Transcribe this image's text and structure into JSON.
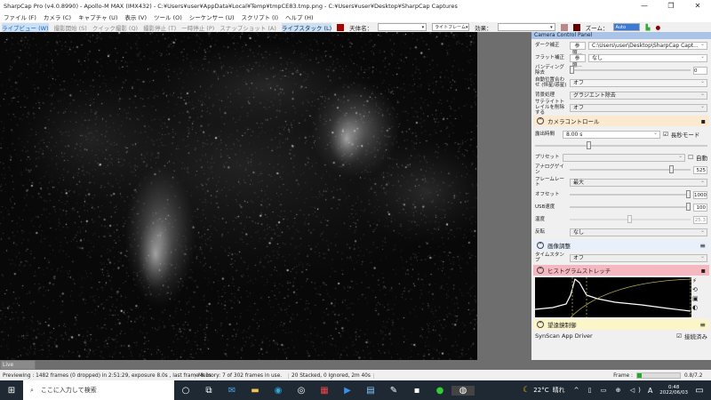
{
  "window": {
    "title": "SharpCap Pro (v4.0.8990) - Apollo-M MAX (IMX432) - C:¥Users¥user¥AppData¥Local¥Temp¥tmpCE83.tmp.png - C:¥Users¥user¥Desktop¥SharpCap Captures",
    "minimize": "—",
    "restore": "❐",
    "close": "✕"
  },
  "menu": [
    "ファイル (F)",
    "カメラ (C)",
    "キャプチャ (U)",
    "表示 (V)",
    "ツール (O)",
    "シーケンサー (U)",
    "スクリプト (I)",
    "ヘルプ (H)"
  ],
  "toolbar": {
    "live_view": "ライブビュー (W)",
    "start_capture": "撮影開始 (S)",
    "quick_capture": "クイック撮影 (Q)",
    "stop_capture": "撮影停止 (T)",
    "pause": "一時停止 (P)",
    "snapshot": "スナップショット (A)",
    "live_stack": "ライブスタック (L)",
    "target_label": "天体名：",
    "frame_type": "ライトフレーム",
    "effect_label": "効果：",
    "zoom_label": "ズーム：",
    "zoom_value": "Auto"
  },
  "panel": {
    "title": "Camera Control Panel",
    "dark_label": "ダーク補正",
    "dark_browse": "参照...",
    "dark_value": "C:\\Users\\user\\Desktop\\SharpCap Capt...",
    "flat_label": "フラット補正",
    "flat_browse": "参照...",
    "flat_value": "なし",
    "banding_label": "バンディング除去",
    "banding_value": "0",
    "align_label": "自動位置合わせ (恒星/惑星)",
    "align_value": "オフ",
    "bg_label": "背景処理",
    "bg_value": "グラジエント除去",
    "sat_label": "サテライトトレイルを削除する",
    "sat_value": "オフ",
    "camera_section": "カメラコントロール",
    "exposure_label": "露出時間",
    "exposure_value": "8.00 s",
    "long_mode": "長秒モード",
    "preset_label": "プリセット",
    "auto_label": "自動",
    "gain_label": "アナログゲイン",
    "gain_value": "525",
    "framerate_label": "フレームレート",
    "framerate_value": "最大",
    "offset_label": "オフセット",
    "offset_value": "1000",
    "usb_label": "USB速度",
    "usb_value": "100",
    "temp_label": "温度",
    "temp_value": "25.3",
    "flip_label": "反転",
    "flip_value": "なし",
    "image_section": "画像調整",
    "timestamp_label": "タイムスタンプ",
    "timestamp_value": "オフ",
    "histogram_section": "ヒストグラムストレッチ",
    "mount_section": "望遠鏡制御",
    "mount_driver": "SynScan App Driver",
    "connected": "接続済み"
  },
  "live_stacking_tab": "Live Stacking",
  "status": {
    "preview": "Previewing : 1482 frames (0 dropped) in 2:51:29, exposure 8.0s , last frame 8.1s",
    "memory": "Memory: 7 of 302 frames in use.",
    "stacked": "20 Stacked, 0 Ignored, 2m 40s",
    "frame_label": "Frame :",
    "frame_value": "0.8/7.2",
    "frame_progress": 0.11
  },
  "taskbar": {
    "search": "ここに入力して検索",
    "weather_temp": "22°C",
    "weather": "晴れ",
    "ime": "A",
    "time": "0:48",
    "date": "2022/06/03"
  },
  "colors": {
    "accent": "#1a5fb4",
    "panel_header": "#a9c4e6",
    "camera_section": "#fbe9d0",
    "histogram_section": "#f5b8c0",
    "mount_section": "#fbf5c8",
    "image_section": "#e8f0fb"
  }
}
